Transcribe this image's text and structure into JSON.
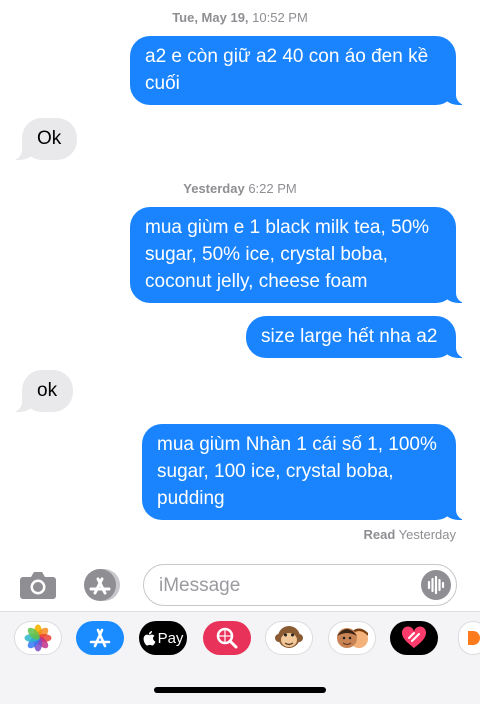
{
  "timestamps": {
    "first": {
      "day": "Tue, May 19,",
      "time": " 10:52 PM"
    },
    "second": {
      "day": "Yesterday",
      "time": " 6:22 PM"
    }
  },
  "messages": [
    {
      "direction": "outgoing",
      "text": "a2 e còn giữ a2 40 con áo đen kề cuối"
    },
    {
      "direction": "incoming",
      "text": "Ok"
    },
    {
      "direction": "outgoing",
      "text": "mua giùm e 1 black milk tea, 50% sugar, 50% ice, crystal boba, coconut jelly, cheese foam"
    },
    {
      "direction": "outgoing",
      "text": "size large hết nha a2"
    },
    {
      "direction": "incoming",
      "text": "ok"
    },
    {
      "direction": "outgoing",
      "text": "mua giùm Nhàn 1 cái số 1, 100% sugar, 100 ice, crystal boba, pudding"
    }
  ],
  "read_receipt": {
    "label": "Read",
    "time": " Yesterday"
  },
  "composer": {
    "placeholder": "iMessage"
  },
  "app_tray": [
    {
      "icon": "photos-icon"
    },
    {
      "icon": "app-store-icon"
    },
    {
      "icon": "apple-pay-icon",
      "label": "Pay"
    },
    {
      "icon": "image-search-icon"
    },
    {
      "icon": "monkey-animoji-icon"
    },
    {
      "icon": "memoji-icon"
    },
    {
      "icon": "digital-touch-icon"
    },
    {
      "icon": "partial-app-icon"
    }
  ],
  "colors": {
    "outgoing_bubble": "#1a84ff",
    "incoming_bubble": "#e9e9eb",
    "meta_text": "#8e8e93"
  }
}
